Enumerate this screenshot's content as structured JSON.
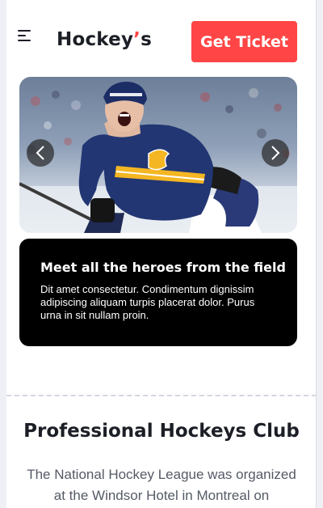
{
  "header": {
    "brand_name": "Hockey",
    "brand_accent": "’",
    "brand_suffix": "s",
    "ticket_label": "Get Ticket"
  },
  "hero": {
    "caption_title": "Meet all the heroes from the field",
    "caption_text": "Dit amet consectetur. Condimentum dignissim adipiscing aliquam turpis placerat dolor. Purus urna in sit nullam proin."
  },
  "about": {
    "title": "Professional Hockeys Club",
    "text": "The National Hockey League was organized at the Windsor Hotel in Montreal on"
  },
  "colors": {
    "accent": "#ff4545",
    "text_dark": "#1c1f26",
    "caption_bg": "#000000"
  },
  "icons": {
    "menu": "menu-icon",
    "prev": "chevron-left-icon",
    "next": "chevron-right-icon"
  }
}
